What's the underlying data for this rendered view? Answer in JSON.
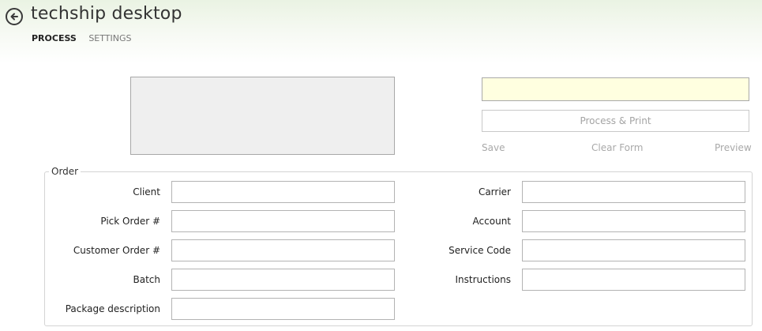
{
  "app": {
    "title": "techship desktop"
  },
  "nav": {
    "tabs": [
      {
        "label": "PROCESS",
        "active": true
      },
      {
        "label": "SETTINGS",
        "active": false
      }
    ]
  },
  "icons": {
    "back": "arrow-left-circle-icon"
  },
  "colors": {
    "header_tint": "#eaf3e3",
    "highlight_field": "#ffffe0",
    "disabled_text": "#a9a9a9"
  },
  "scan_input": {
    "value": ""
  },
  "process_button": {
    "label": "Process & Print"
  },
  "actions": {
    "save": "Save",
    "clear_form": "Clear Form",
    "preview": "Preview"
  },
  "order": {
    "legend": "Order",
    "left_fields": [
      {
        "label": "Client",
        "value": ""
      },
      {
        "label": "Pick Order #",
        "value": ""
      },
      {
        "label": "Customer Order #",
        "value": ""
      },
      {
        "label": "Batch",
        "value": ""
      },
      {
        "label": "Package description",
        "value": ""
      }
    ],
    "right_fields": [
      {
        "label": "Carrier",
        "value": ""
      },
      {
        "label": "Account",
        "value": ""
      },
      {
        "label": "Service Code",
        "value": ""
      },
      {
        "label": "Instructions",
        "value": ""
      }
    ]
  }
}
